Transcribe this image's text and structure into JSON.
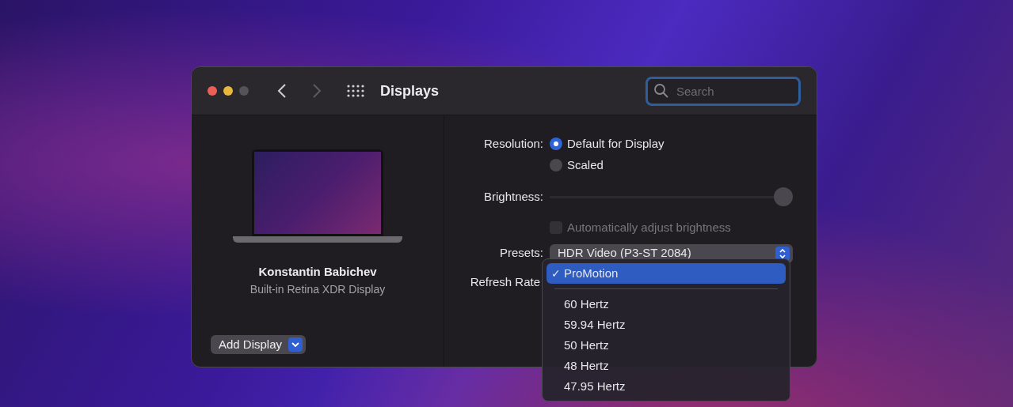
{
  "window": {
    "title": "Displays",
    "search": {
      "placeholder": "Search"
    }
  },
  "display": {
    "name": "Konstantin Babichev",
    "description": "Built-in Retina XDR Display",
    "add_button": "Add Display"
  },
  "resolution": {
    "label": "Resolution:",
    "options": [
      {
        "label": "Default for Display",
        "selected": true
      },
      {
        "label": "Scaled",
        "selected": false
      }
    ]
  },
  "brightness": {
    "label": "Brightness:",
    "level": 1.0
  },
  "auto_brightness": {
    "label": "Automatically adjust brightness",
    "checked": false,
    "disabled": true
  },
  "presets": {
    "label": "Presets:",
    "value": "HDR Video (P3-ST 2084)"
  },
  "refresh_rate": {
    "label": "Refresh Rate",
    "check": "✓",
    "menu": [
      {
        "label": "ProMotion",
        "selected": true
      },
      {
        "label": "60 Hertz",
        "selected": false
      },
      {
        "label": "59.94 Hertz",
        "selected": false
      },
      {
        "label": "50 Hertz",
        "selected": false
      },
      {
        "label": "48 Hertz",
        "selected": false
      },
      {
        "label": "47.95 Hertz",
        "selected": false
      }
    ]
  }
}
